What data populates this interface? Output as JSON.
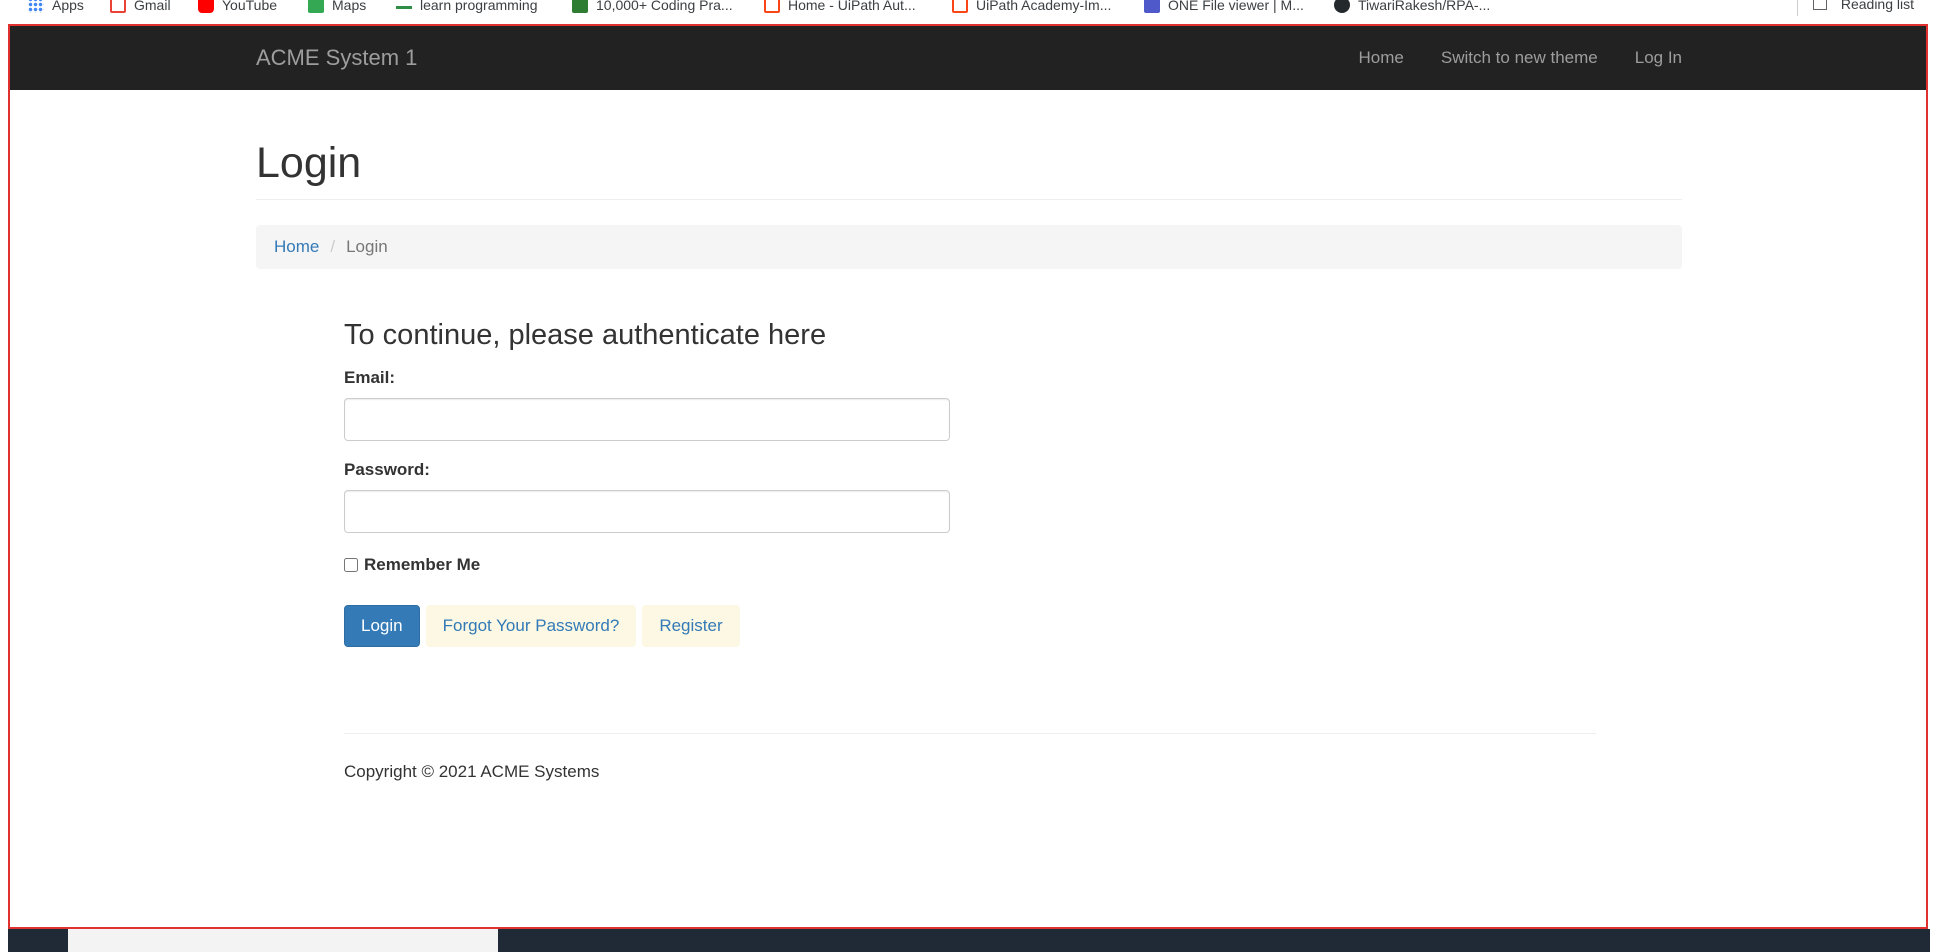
{
  "bookmarks": {
    "items": [
      {
        "label": "Apps",
        "color": "#4285f4"
      },
      {
        "label": "Gmail",
        "color": "#ea4335"
      },
      {
        "label": "YouTube",
        "color": "#ff0000"
      },
      {
        "label": "Maps",
        "color": "#34a853"
      },
      {
        "label": "learn programming",
        "color": "#2f8d46"
      },
      {
        "label": "10,000+ Coding Pra...",
        "color": "#2e7d32"
      },
      {
        "label": "Home - UiPath Aut...",
        "color": "#fa4616"
      },
      {
        "label": "UiPath Academy-Im...",
        "color": "#fa4616"
      },
      {
        "label": "ONE File viewer | M...",
        "color": "#5059c9"
      },
      {
        "label": "TiwariRakesh/RPA-...",
        "color": "#24292e"
      }
    ],
    "reading_list": "Reading list"
  },
  "navbar": {
    "brand": "ACME System 1",
    "links": [
      "Home",
      "Switch to new theme",
      "Log In"
    ]
  },
  "page": {
    "title": "Login",
    "breadcrumb": {
      "home": "Home",
      "divider": "/",
      "current": "Login"
    }
  },
  "form": {
    "heading": "To continue, please authenticate here",
    "email_label": "Email:",
    "email_value": "",
    "password_label": "Password:",
    "password_value": "",
    "remember_label": "Remember Me",
    "remember_checked": false,
    "login_button": "Login",
    "forgot_button": "Forgot Your Password?",
    "register_button": "Register"
  },
  "footer": {
    "copyright": "Copyright © 2021 ACME Systems"
  },
  "colors": {
    "navbar_bg": "#222222",
    "primary": "#337ab7",
    "link_button_bg": "#fcf8e3",
    "frame_border": "#e03030"
  }
}
